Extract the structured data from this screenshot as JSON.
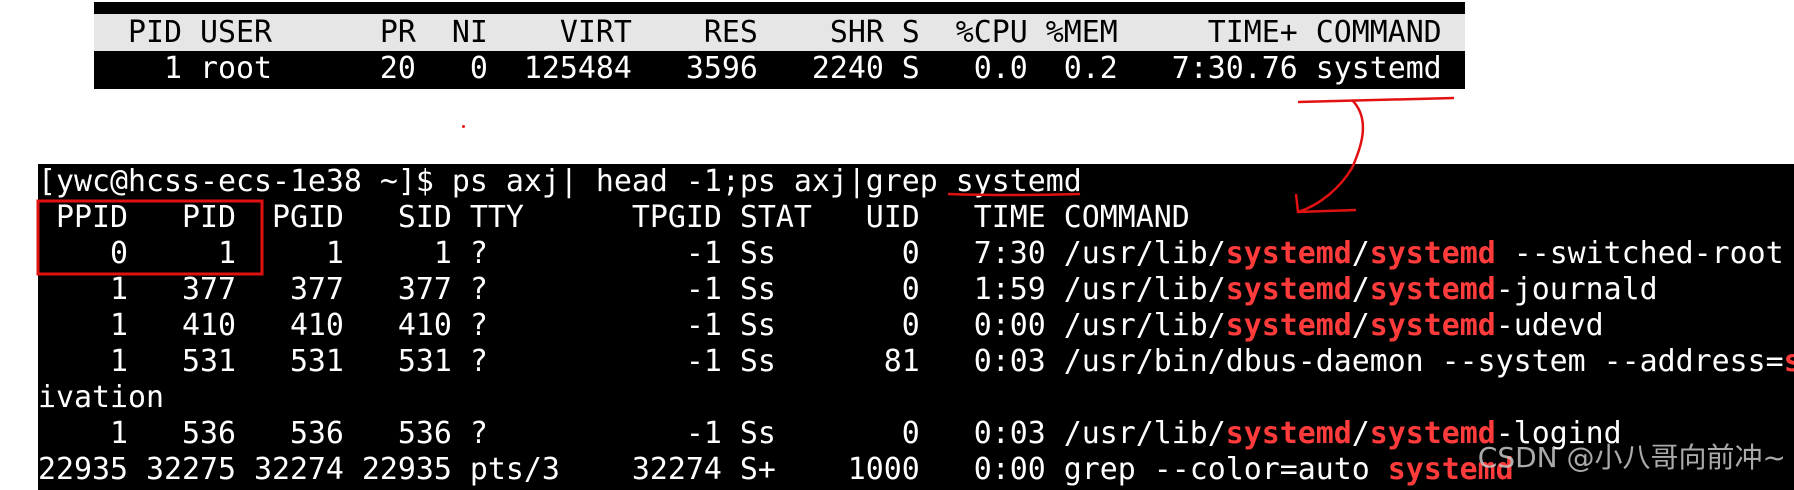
{
  "top_table": {
    "header": " PID USER      PR  NI    VIRT    RES    SHR S  %CPU %MEM     TIME+ COMMAND",
    "row": "   1 root      20   0  125484   3596   2240 S   0.0  0.2   7:30.76 systemd"
  },
  "terminal": {
    "prompt": {
      "before": "[ywc@hcss-ecs-1e38 ~]$ ps axj| head -1;ps axj|grep ",
      "arg": "systemd"
    },
    "header": " PPID   PID  PGID   SID TTY      TPGID STAT   UID   TIME COMMAND",
    "lines": [
      {
        "cols": "    0     1     1     1 ?           -1 Ss       0   7:30 ",
        "parts": [
          "/usr/lib/",
          "systemd",
          "/",
          "systemd",
          " --switched-root --s"
        ]
      },
      {
        "cols": "    1   377   377   377 ?           -1 Ss       0   1:59 ",
        "parts": [
          "/usr/lib/",
          "systemd",
          "/",
          "systemd",
          "-journald"
        ]
      },
      {
        "cols": "    1   410   410   410 ?           -1 Ss       0   0:00 ",
        "parts": [
          "/usr/lib/",
          "systemd",
          "/",
          "systemd",
          "-udevd"
        ]
      },
      {
        "cols": "    1   531   531   531 ?           -1 Ss      81   0:03 ",
        "parts": [
          "/usr/bin/dbus-daemon --system --address=",
          "s",
          "",
          "",
          ""
        ]
      },
      {
        "cols": "ivation",
        "parts": [
          "",
          "",
          "",
          "",
          ""
        ]
      },
      {
        "cols": "    1   536   536   536 ?           -1 Ss       0   0:03 ",
        "parts": [
          "/usr/lib/",
          "systemd",
          "/",
          "systemd",
          "-logind"
        ]
      },
      {
        "cols": "22935 32275 32274 22935 pts/3    32274 S+    1000   0:00 ",
        "parts": [
          "grep --color=auto ",
          "systemd",
          "",
          "",
          ""
        ]
      }
    ]
  },
  "watermark": "CSDN @小八哥向前冲~",
  "colors": {
    "highlight": "#ff3b3b",
    "annotation": "#e11111"
  }
}
